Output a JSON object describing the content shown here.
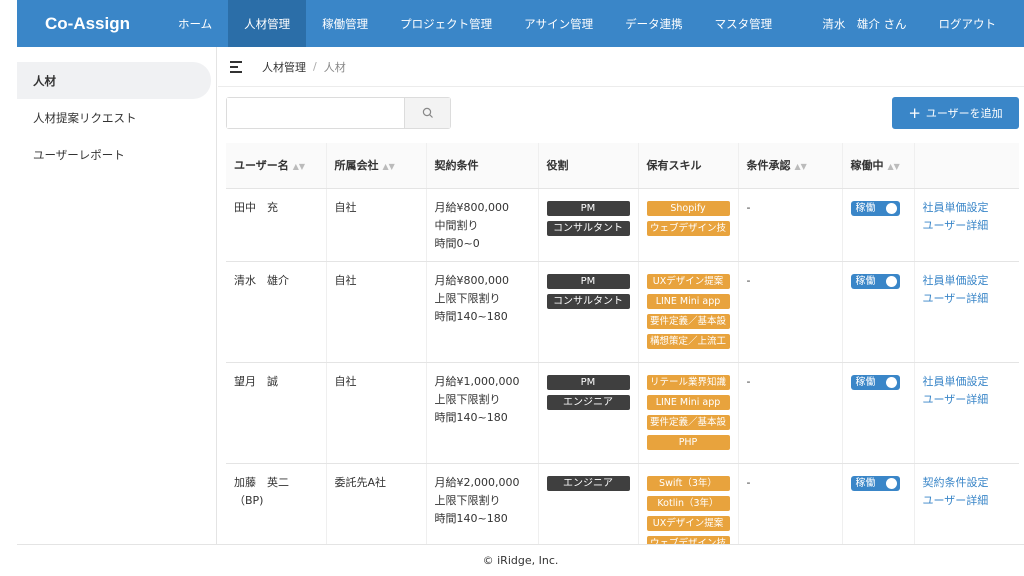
{
  "app": {
    "brand": "Co-Assign"
  },
  "nav": {
    "items": [
      "ホーム",
      "人材管理",
      "稼働管理",
      "プロジェクト管理",
      "アサイン管理",
      "データ連携",
      "マスタ管理"
    ],
    "active_index": 1,
    "user": "清水　雄介 さん",
    "logout": "ログアウト"
  },
  "sidebar": {
    "items": [
      "人材",
      "人材提案リクエスト",
      "ユーザーレポート"
    ],
    "active_index": 0
  },
  "breadcrumb": {
    "parent": "人材管理",
    "separator": "/",
    "current": "人材"
  },
  "search": {
    "value": "",
    "placeholder": ""
  },
  "add_button": {
    "icon": "plus-icon",
    "label": "ユーザーを追加"
  },
  "table": {
    "columns": [
      "ユーザー名",
      "所属会社",
      "契約条件",
      "役割",
      "保有スキル",
      "条件承認",
      "稼働中",
      ""
    ],
    "sortable": [
      true,
      true,
      false,
      false,
      false,
      true,
      true,
      false
    ],
    "rows": [
      {
        "name": "田中　充",
        "company": "自社",
        "contract": [
          "月給¥800,000",
          "中間割り",
          "時間0~0"
        ],
        "roles": [
          "PM",
          "コンサルタント"
        ],
        "skills": [
          "Shopify",
          "ウェブデザイン技"
        ],
        "approval": "-",
        "active_label": "稼働",
        "links": [
          "社員単価設定",
          "ユーザー詳細"
        ]
      },
      {
        "name": "清水　雄介",
        "company": "自社",
        "contract": [
          "月給¥800,000",
          "上限下限割り",
          "時間140~180"
        ],
        "roles": [
          "PM",
          "コンサルタント"
        ],
        "skills": [
          "UXデザイン提案",
          "LINE Mini app",
          "要件定義／基本設",
          "構想策定／上流工"
        ],
        "approval": "-",
        "active_label": "稼働",
        "links": [
          "社員単価設定",
          "ユーザー詳細"
        ]
      },
      {
        "name": "望月　誠",
        "company": "自社",
        "contract": [
          "月給¥1,000,000",
          "上限下限割り",
          "時間140~180"
        ],
        "roles": [
          "PM",
          "エンジニア"
        ],
        "skills": [
          "リテール業界知識",
          "LINE Mini app",
          "要件定義／基本設",
          "PHP"
        ],
        "approval": "-",
        "active_label": "稼働",
        "links": [
          "社員単価設定",
          "ユーザー詳細"
        ]
      },
      {
        "name": "加藤　英二（BP)",
        "company": "委託先A社",
        "contract": [
          "月給¥2,000,000",
          "上限下限割り",
          "時間140~180"
        ],
        "roles": [
          "エンジニア"
        ],
        "skills": [
          "Swift（3年）",
          "Kotlin（3年）",
          "UXデザイン提案",
          "ウェブデザイン技"
        ],
        "approval": "-",
        "active_label": "稼働",
        "links": [
          "契約条件設定",
          "ユーザー詳細"
        ]
      }
    ]
  },
  "footer": {
    "text": "© iRidge, Inc."
  },
  "colors": {
    "primary": "#3a86c8",
    "primary_dark": "#2b6ea8",
    "role_badge": "#3f3f3f",
    "skill_badge": "#e8a33d"
  }
}
